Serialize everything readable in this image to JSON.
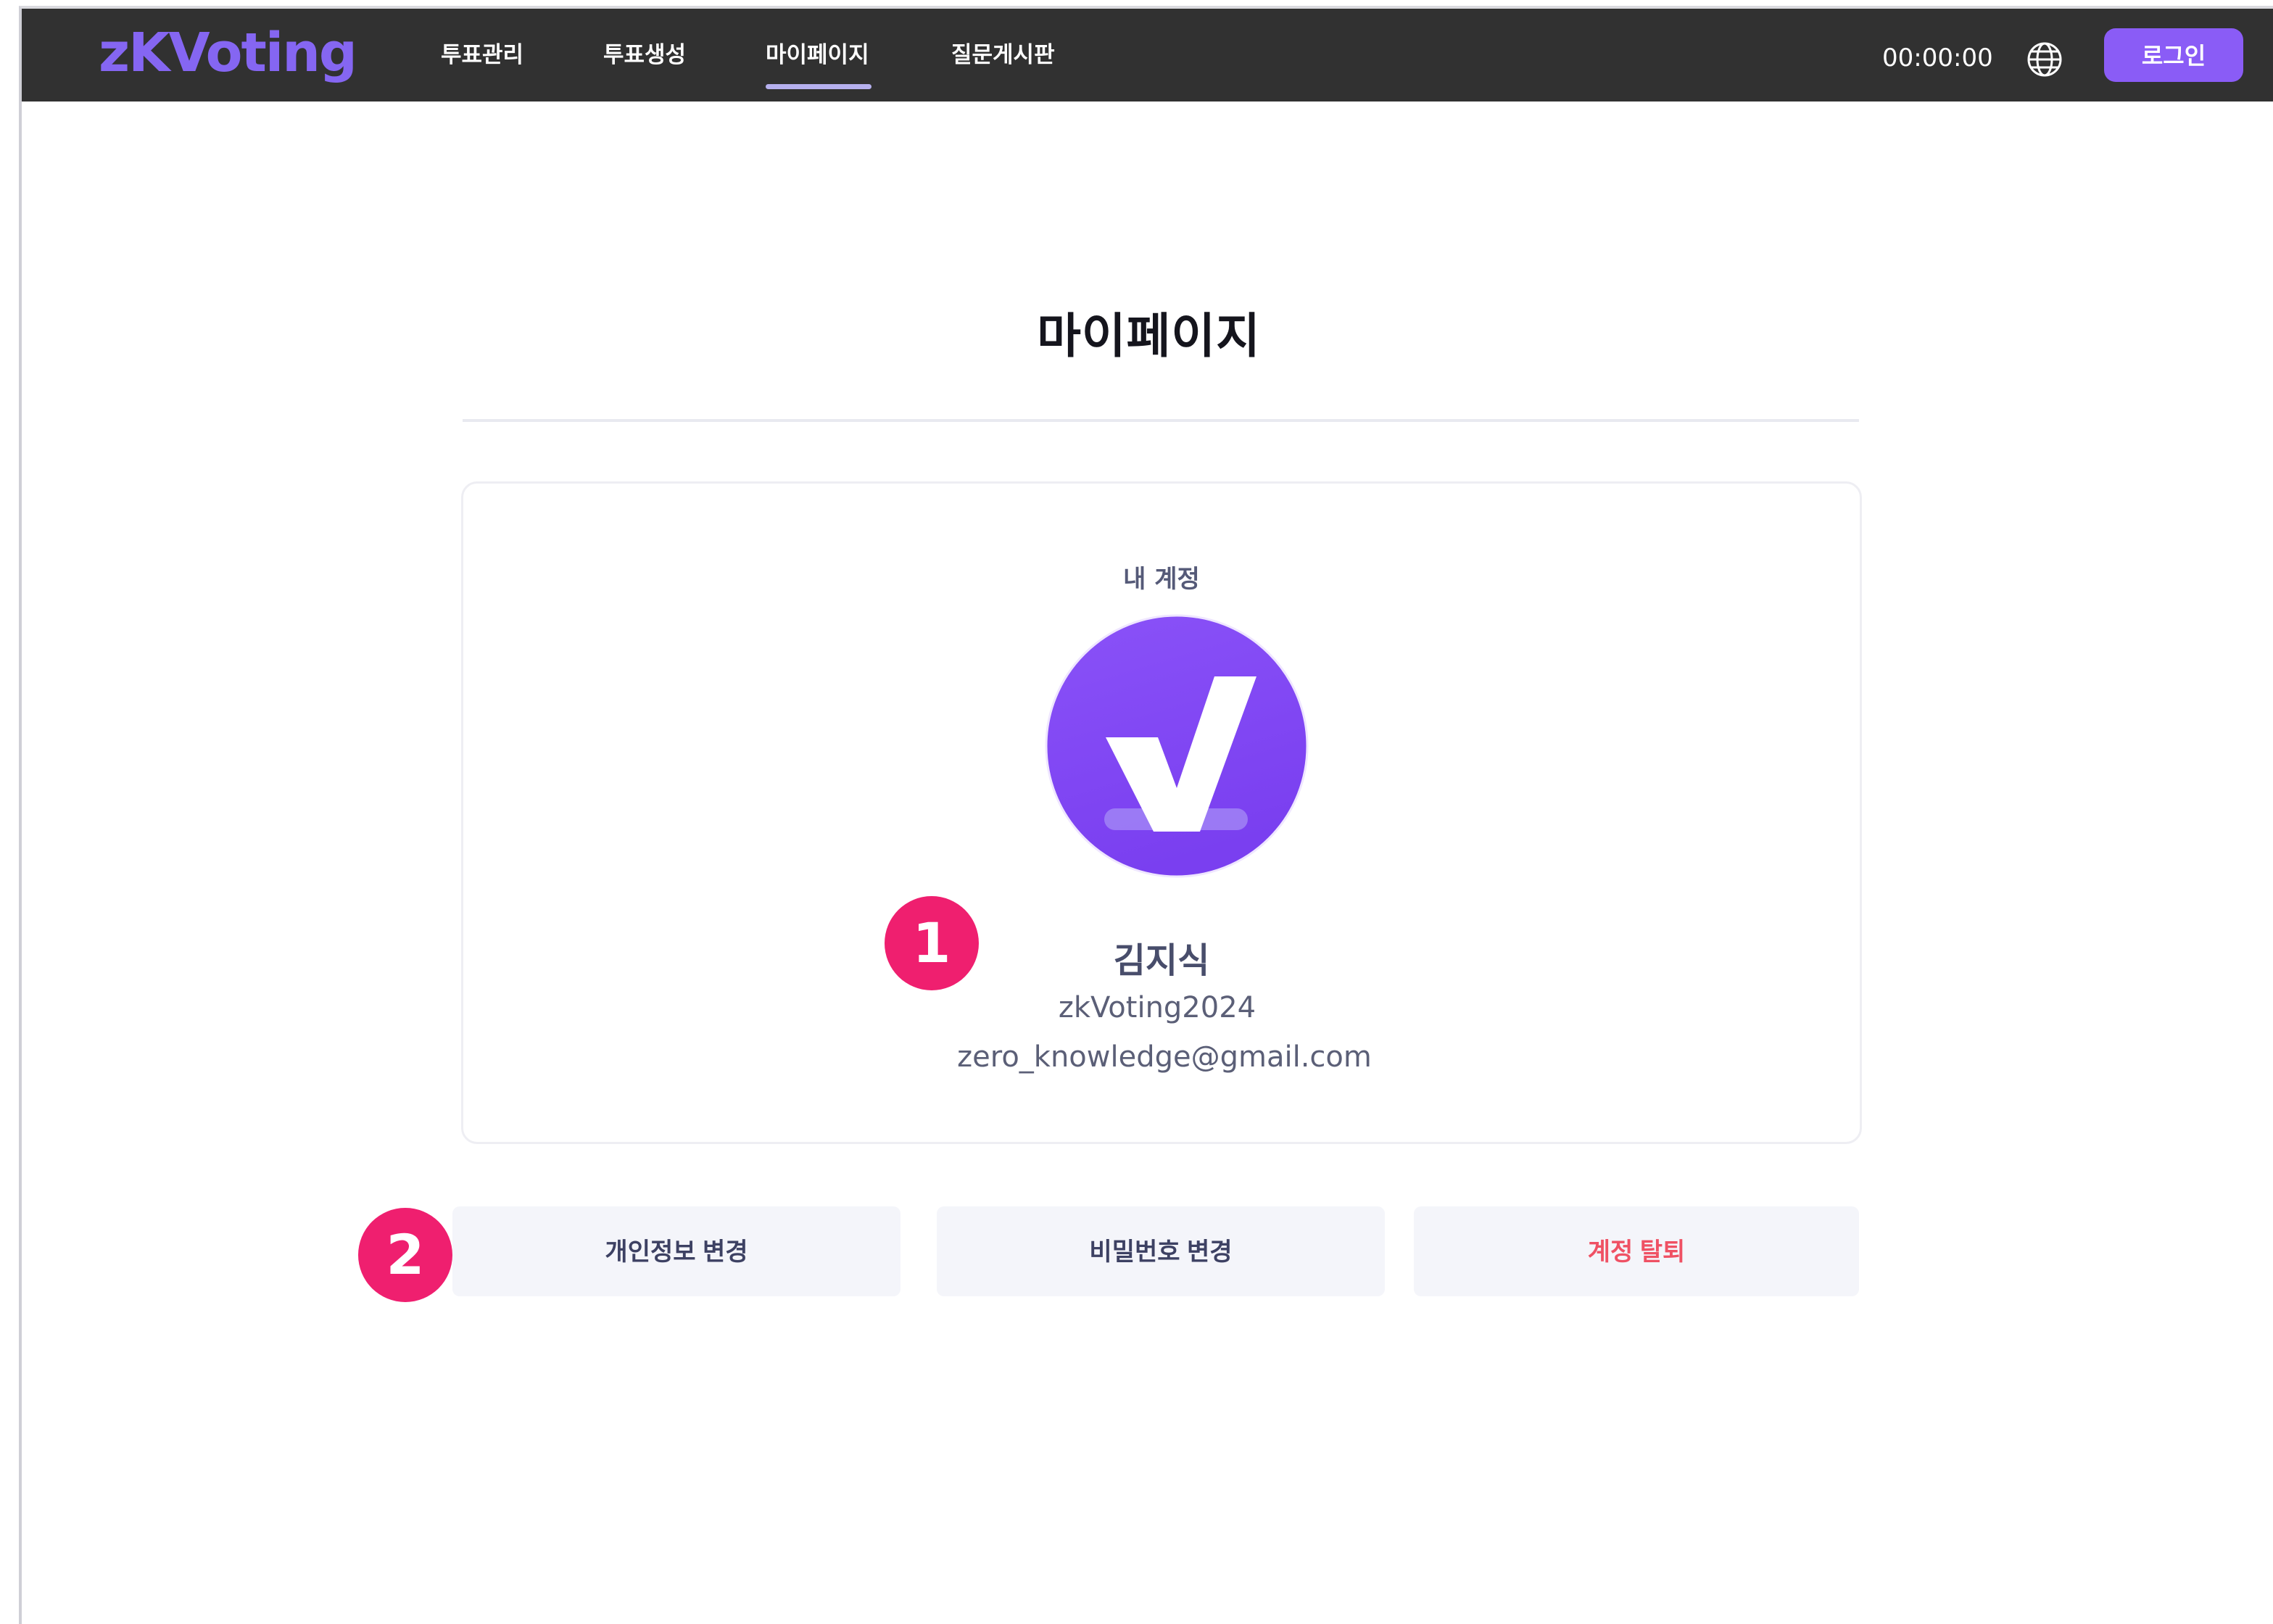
{
  "header": {
    "logo": "zKVoting",
    "nav": [
      {
        "label": "투표관리"
      },
      {
        "label": "투표생성"
      },
      {
        "label": "마이페이지",
        "active": true
      },
      {
        "label": "질문게시판"
      }
    ],
    "timer": "00:00:00",
    "login_label": "로그인"
  },
  "page": {
    "title": "마이페이지"
  },
  "account": {
    "section_label": "내 계정",
    "name": "김지식",
    "user_id": "zkVoting2024",
    "email": "zero_knowledge@gmail.com"
  },
  "actions": {
    "edit_profile": "개인정보 변경",
    "change_password": "비밀번호 변경",
    "delete_account": "계정 탈퇴"
  },
  "annotations": {
    "marker_1": "1",
    "marker_2": "2"
  },
  "colors": {
    "brand": "#8a5cf6",
    "topbar": "#313131",
    "marker": "#ef1f6f",
    "danger": "#ef5164"
  }
}
